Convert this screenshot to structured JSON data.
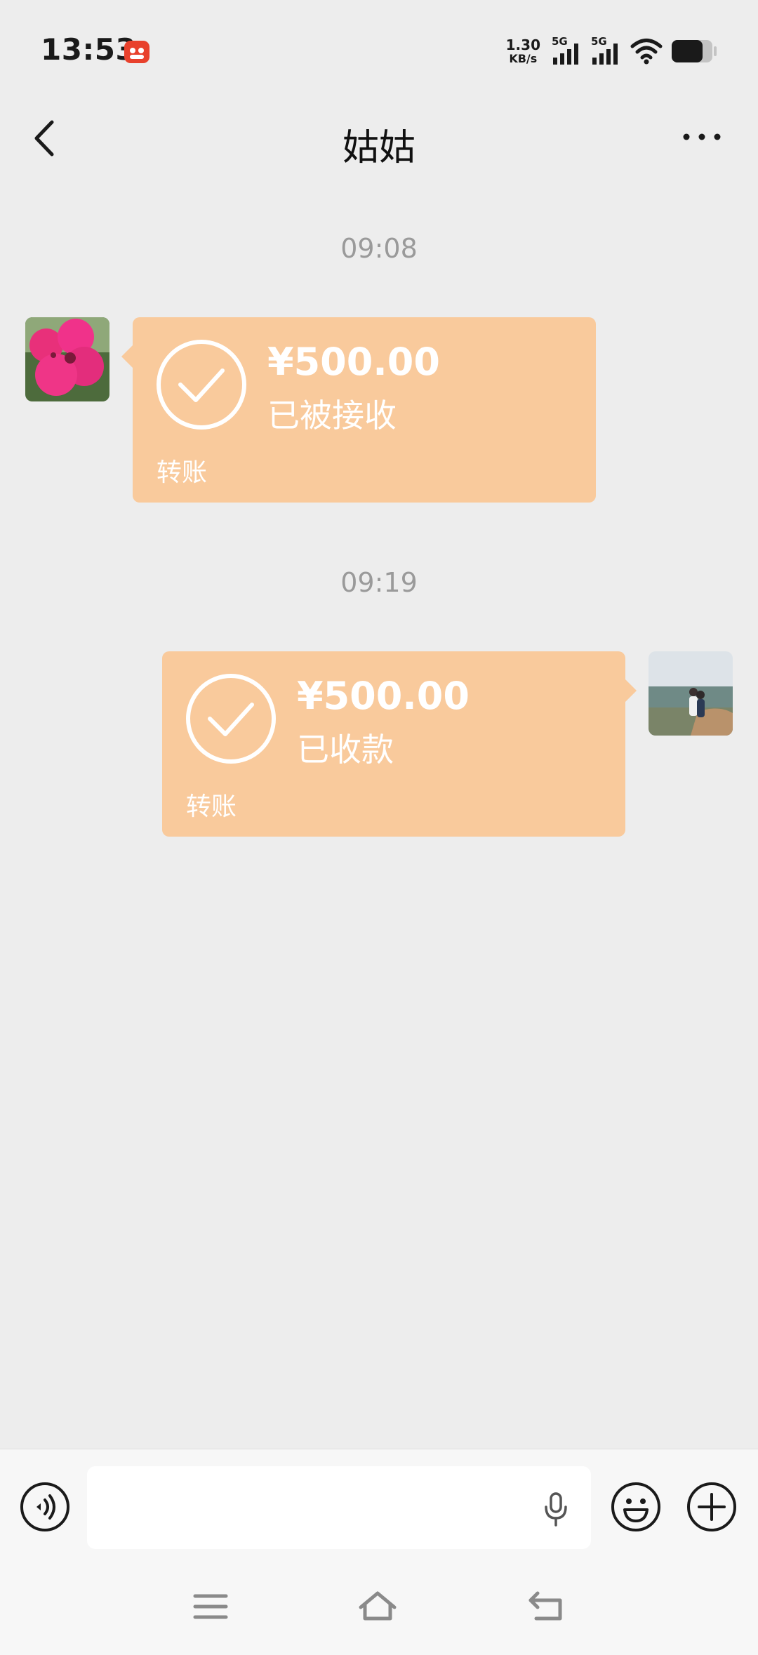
{
  "status_bar": {
    "time": "13:53",
    "net_speed_value": "1.30",
    "net_speed_unit": "KB/s",
    "sim1": "5G",
    "sim2": "5G"
  },
  "header": {
    "title": "姑姑"
  },
  "messages": [
    {
      "timestamp": "09:08",
      "direction": "incoming",
      "amount": "¥500.00",
      "status": "已被接收",
      "type_label": "转账"
    },
    {
      "timestamp": "09:19",
      "direction": "outgoing",
      "amount": "¥500.00",
      "status": "已收款",
      "type_label": "转账"
    }
  ],
  "icons": {
    "back": "chevron-left-icon",
    "more": "more-dots-icon",
    "voice": "voice-icon",
    "mic": "mic-icon",
    "emoji": "emoji-icon",
    "plus": "plus-icon",
    "check": "check-circle-icon"
  },
  "colors": {
    "background": "#ededed",
    "transfer_card": "#f9ca9c",
    "timestamp": "#9a9a9a"
  }
}
